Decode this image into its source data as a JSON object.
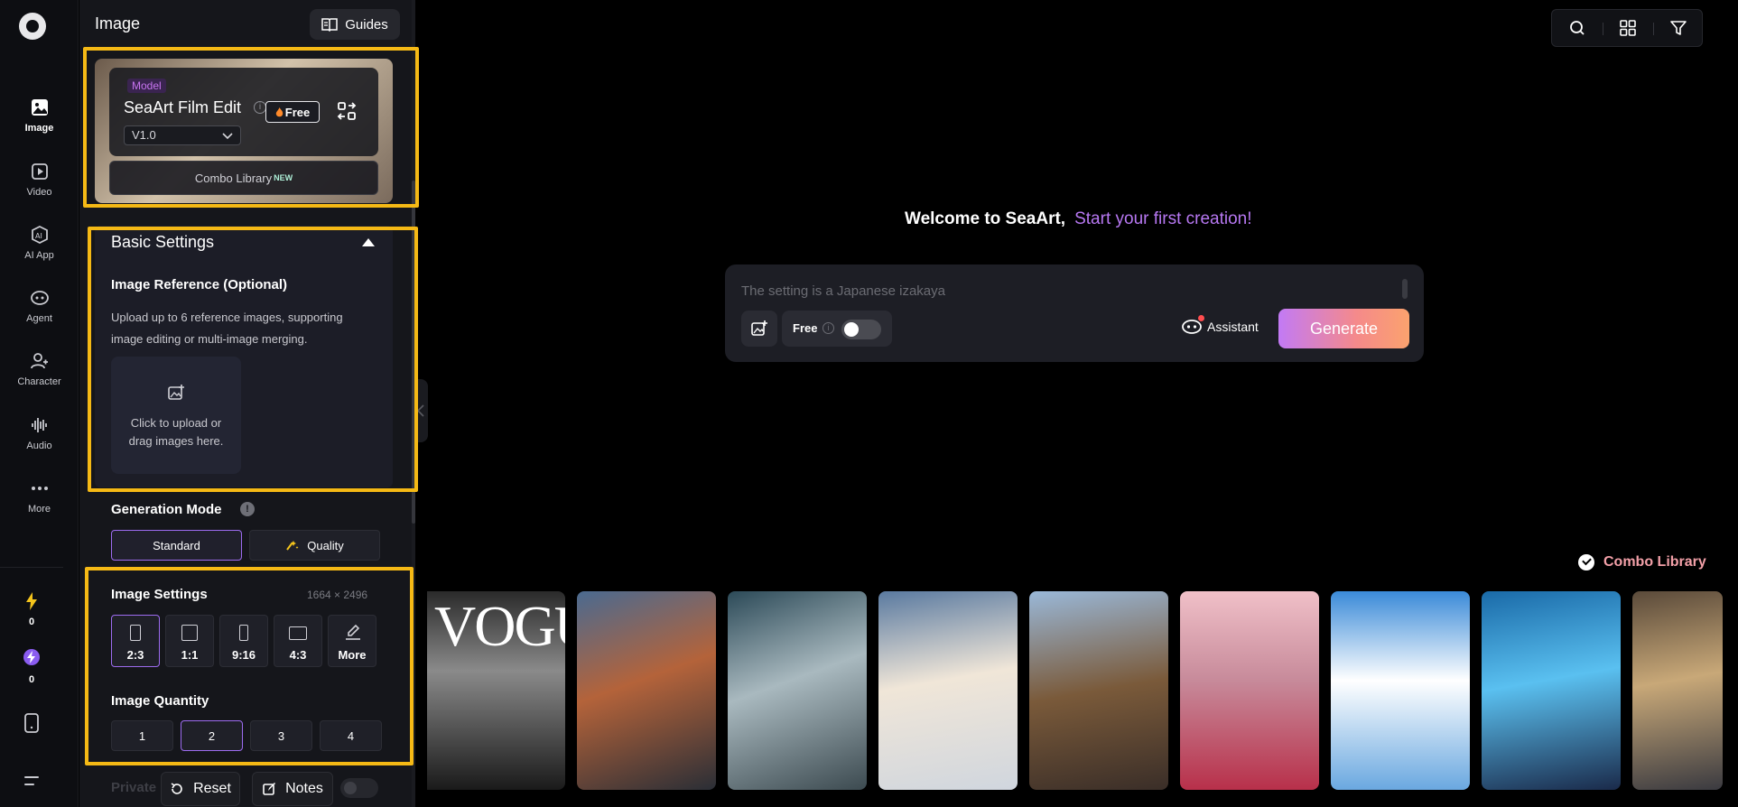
{
  "rail": {
    "items": [
      {
        "label": "Image",
        "icon": "image-icon"
      },
      {
        "label": "Video",
        "icon": "video-icon"
      },
      {
        "label": "AI App",
        "icon": "ai-app-icon"
      },
      {
        "label": "Agent",
        "icon": "agent-icon"
      },
      {
        "label": "Character",
        "icon": "character-icon"
      },
      {
        "label": "Audio",
        "icon": "audio-icon"
      },
      {
        "label": "More",
        "icon": "more-icon"
      }
    ],
    "stamina": "0",
    "energy": "0"
  },
  "panel": {
    "title": "Image",
    "guides_label": "Guides",
    "model": {
      "tag": "Model",
      "name": "SeaArt Film Edit",
      "info": "i",
      "free_label": "Free",
      "version": "V1.0",
      "combo_library": "Combo Library",
      "combo_badge": "NEW"
    },
    "basic_settings": {
      "title": "Basic Settings",
      "ref_title": "Image Reference (Optional)",
      "ref_desc": "Upload up to 6 reference images, supporting image editing or multi-image merging.",
      "upload_line1": "Click to upload or",
      "upload_line2": "drag images here."
    },
    "generation_mode": {
      "title": "Generation Mode",
      "info": "!",
      "options": [
        "Standard",
        "Quality"
      ],
      "selected": "Standard"
    },
    "image_settings": {
      "title": "Image Settings",
      "dimensions": "1664 × 2496",
      "ratios": [
        "2:3",
        "1:1",
        "9:16",
        "4:3",
        "More"
      ],
      "selected": "2:3"
    },
    "image_quantity": {
      "title": "Image Quantity",
      "options": [
        "1",
        "2",
        "3",
        "4"
      ],
      "selected": "2"
    },
    "private_label": "Private",
    "reset_label": "Reset",
    "notes_label": "Notes"
  },
  "main": {
    "welcome": "Welcome to SeaArt,",
    "welcome_accent": "Start your first creation!",
    "prompt_placeholder": "The setting is a Japanese izakaya",
    "free_label": "Free",
    "free_info": "i",
    "assistant_label": "Assistant",
    "generate_label": "Generate",
    "combo_library_link": "Combo Library",
    "gallery_first_text": "VOGU"
  },
  "colors": {
    "accent_purple": "#b778f2",
    "highlight": "#f5b915",
    "combo_link": "#f3a0a8"
  }
}
